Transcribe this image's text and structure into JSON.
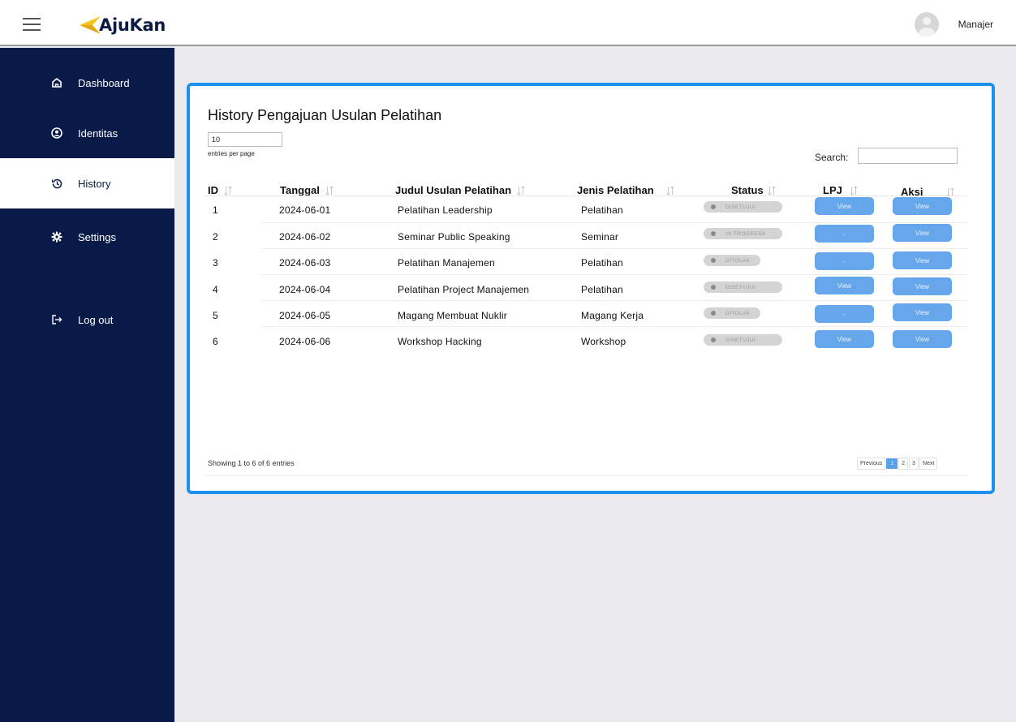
{
  "header": {
    "brand": "AjuKan",
    "user_name": "Manajer"
  },
  "sidebar": {
    "items": [
      {
        "label": "Dashboard"
      },
      {
        "label": "Identitas"
      },
      {
        "label": "History"
      },
      {
        "label": "Settings"
      },
      {
        "label": "Log out"
      }
    ]
  },
  "main": {
    "title": "History Pengajuan Usulan Pelatihan",
    "per_page_value": "10",
    "per_page_label": "entries per page",
    "search_label": "Search:",
    "search_value": "",
    "columns": [
      "ID",
      "Tanggal",
      "Judul Usulan Pelatihan",
      "Jenis Pelatihan",
      "Status",
      "LPJ",
      "Aksi"
    ],
    "rows": [
      {
        "id": "1",
        "tanggal": "2024-06-01",
        "judul": "Pelatihan Leadership",
        "jenis": "Pelatihan",
        "status": "DISETUJUI",
        "lpj": "View",
        "aksi": "View"
      },
      {
        "id": "2",
        "tanggal": "2024-06-02",
        "judul": "Seminar Public Speaking",
        "jenis": "Seminar",
        "status": "IN PROGRESS",
        "lpj": "-",
        "aksi": "View"
      },
      {
        "id": "3",
        "tanggal": "2024-06-03",
        "judul": "Pelatihan Manajemen",
        "jenis": "Pelatihan",
        "status": "DITOLAK",
        "lpj": "-",
        "aksi": "View"
      },
      {
        "id": "4",
        "tanggal": "2024-06-04",
        "judul": "Pelatihan Project Manajemen",
        "jenis": "Pelatihan",
        "status": "DISETUJUI",
        "lpj": "View",
        "aksi": "View"
      },
      {
        "id": "5",
        "tanggal": "2024-06-05",
        "judul": "Magang Membuat Nuklir",
        "jenis": "Magang Kerja",
        "status": "DITOLAK",
        "lpj": "-",
        "aksi": "View"
      },
      {
        "id": "6",
        "tanggal": "2024-06-06",
        "judul": "Workshop Hacking",
        "jenis": "Workshop",
        "status": "DISETUJUI",
        "lpj": "View",
        "aksi": "View"
      }
    ],
    "showing_text": "Showing 1 to 6 of 6 entries",
    "pagination": {
      "previous": "Previous",
      "pages": [
        "1",
        "2",
        "3"
      ],
      "next": "Next"
    }
  },
  "colors": {
    "sidebar_bg": "#0a1a48",
    "accent_border": "#1e90f0",
    "button_bg": "#66a7ec",
    "logo_yellow": "#f6c51c"
  }
}
